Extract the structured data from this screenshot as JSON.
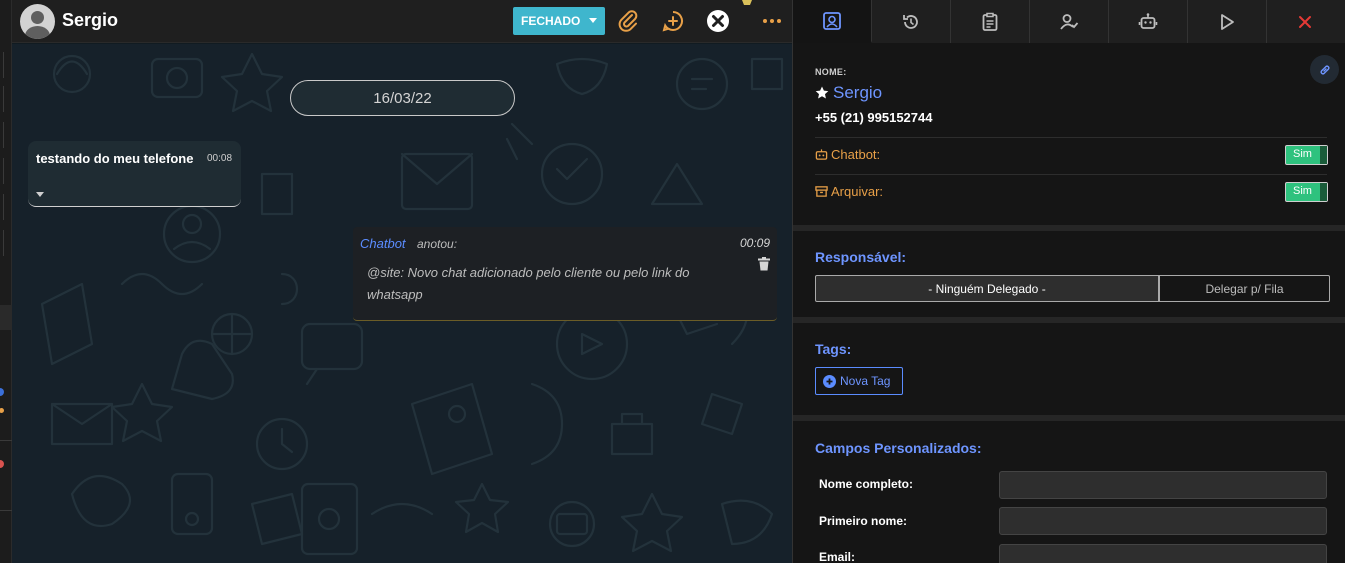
{
  "contact": {
    "name": "Sergio"
  },
  "header": {
    "status_label": "FECHADO"
  },
  "chat": {
    "date": "16/03/22",
    "message": {
      "text": "testando do meu telefone",
      "time": "00:08"
    },
    "note": {
      "author": "Chatbot",
      "verb": "anotou:",
      "time": "00:09",
      "body": "@site: Novo chat adicionado pelo cliente ou pelo link do whatsapp"
    }
  },
  "panel": {
    "name_label": "NOME:",
    "name": "Sergio",
    "phone": "+55 (21) 995152744",
    "chatbot": {
      "label": "Chatbot:",
      "value": "Sim"
    },
    "archive": {
      "label": "Arquivar:",
      "value": "Sim"
    },
    "responsible": {
      "title": "Responsável:",
      "assigned": "- Ninguém Delegado -",
      "queue_button": "Delegar p/ Fila"
    },
    "tags": {
      "title": "Tags:",
      "new_tag": "Nova Tag"
    },
    "custom_fields": {
      "title": "Campos Personalizados:",
      "fields": [
        {
          "label": "Nome completo:",
          "value": ""
        },
        {
          "label": "Primeiro nome:",
          "value": ""
        },
        {
          "label": "Email:",
          "value": ""
        }
      ]
    }
  },
  "colors": {
    "accent": "#6e95ff",
    "status_button": "#3fb6cd",
    "toggle_on": "#2ec27e",
    "orange_label": "#e8a048",
    "close": "#e53935"
  }
}
